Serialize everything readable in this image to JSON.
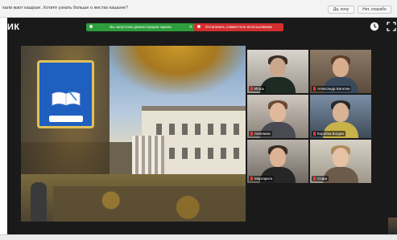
{
  "prompt": {
    "text": "хали жаот кашрые. Хотите узнать больше о жестах кашыне?",
    "yes_label": "Да, хочу",
    "no_label": "Нет, спасибо"
  },
  "app": {
    "title": "ИК"
  },
  "banners": {
    "presenting": "Вы запустили демонстрацию экрана",
    "stop_sharing": "Остановить совместное использование",
    "close_symbol": "✕"
  },
  "emblem": {
    "text": "",
    "ribbon": ""
  },
  "participants": [
    {
      "name": "Игорь"
    },
    {
      "name": "Александр Багитин"
    },
    {
      "name": "Ангелина"
    },
    {
      "name": "Коробка Богдан"
    },
    {
      "name": "Маргарита"
    },
    {
      "name": "Софи"
    }
  ],
  "icons": {
    "clock": "clock-icon",
    "expand": "expand-icon",
    "mic": "mic-muted-icon"
  },
  "colors": {
    "green_banner": "#2e9e3c",
    "red_banner": "#d32f2f",
    "active_speaker": "#e6d31a",
    "emblem_blue": "#1f5fbf"
  }
}
